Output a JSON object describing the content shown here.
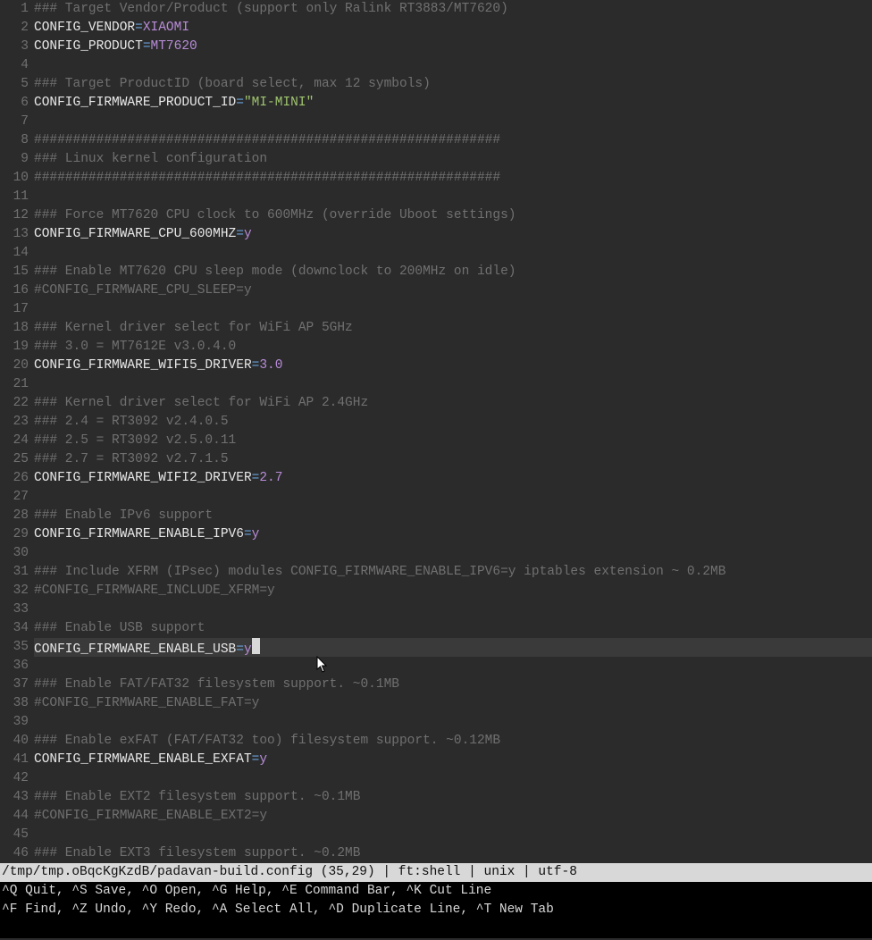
{
  "lines": [
    {
      "n": 1,
      "t": [
        [
          "### Target Vendor/Product (support only Ralink RT3883/MT7620)",
          "comment"
        ]
      ]
    },
    {
      "n": 2,
      "t": [
        [
          "CONFIG_VENDOR",
          "var"
        ],
        [
          "=",
          "op"
        ],
        [
          "XIAOMI",
          "val"
        ]
      ]
    },
    {
      "n": 3,
      "t": [
        [
          "CONFIG_PRODUCT",
          "var"
        ],
        [
          "=",
          "op"
        ],
        [
          "MT7620",
          "val"
        ]
      ]
    },
    {
      "n": 4,
      "t": [
        [
          "",
          ""
        ]
      ]
    },
    {
      "n": 5,
      "t": [
        [
          "### Target ProductID (board select, max 12 symbols)",
          "comment"
        ]
      ]
    },
    {
      "n": 6,
      "t": [
        [
          "CONFIG_FIRMWARE_PRODUCT_ID",
          "var"
        ],
        [
          "=",
          "op"
        ],
        [
          "\"MI-MINI\"",
          "str"
        ]
      ]
    },
    {
      "n": 7,
      "t": [
        [
          "",
          ""
        ]
      ]
    },
    {
      "n": 8,
      "t": [
        [
          "############################################################",
          "comment"
        ]
      ]
    },
    {
      "n": 9,
      "t": [
        [
          "### Linux kernel configuration",
          "comment"
        ]
      ]
    },
    {
      "n": 10,
      "t": [
        [
          "############################################################",
          "comment"
        ]
      ]
    },
    {
      "n": 11,
      "t": [
        [
          "",
          ""
        ]
      ]
    },
    {
      "n": 12,
      "t": [
        [
          "### Force MT7620 CPU clock to 600MHz (override Uboot settings)",
          "comment"
        ]
      ]
    },
    {
      "n": 13,
      "t": [
        [
          "CONFIG_FIRMWARE_CPU_600MHZ",
          "var"
        ],
        [
          "=",
          "op"
        ],
        [
          "y",
          "val"
        ]
      ]
    },
    {
      "n": 14,
      "t": [
        [
          "",
          ""
        ]
      ]
    },
    {
      "n": 15,
      "t": [
        [
          "### Enable MT7620 CPU sleep mode (downclock to 200MHz on idle)",
          "comment"
        ]
      ]
    },
    {
      "n": 16,
      "t": [
        [
          "#CONFIG_FIRMWARE_CPU_SLEEP=y",
          "comment"
        ]
      ]
    },
    {
      "n": 17,
      "t": [
        [
          "",
          ""
        ]
      ]
    },
    {
      "n": 18,
      "t": [
        [
          "### Kernel driver select for WiFi AP 5GHz",
          "comment"
        ]
      ]
    },
    {
      "n": 19,
      "t": [
        [
          "### 3.0 = MT7612E v3.0.4.0",
          "comment"
        ]
      ]
    },
    {
      "n": 20,
      "t": [
        [
          "CONFIG_FIRMWARE_WIFI5_DRIVER",
          "var"
        ],
        [
          "=",
          "op"
        ],
        [
          "3.0",
          "val"
        ]
      ]
    },
    {
      "n": 21,
      "t": [
        [
          "",
          ""
        ]
      ]
    },
    {
      "n": 22,
      "t": [
        [
          "### Kernel driver select for WiFi AP 2.4GHz",
          "comment"
        ]
      ]
    },
    {
      "n": 23,
      "t": [
        [
          "### 2.4 = RT3092 v2.4.0.5",
          "comment"
        ]
      ]
    },
    {
      "n": 24,
      "t": [
        [
          "### 2.5 = RT3092 v2.5.0.11",
          "comment"
        ]
      ]
    },
    {
      "n": 25,
      "t": [
        [
          "### 2.7 = RT3092 v2.7.1.5",
          "comment"
        ]
      ]
    },
    {
      "n": 26,
      "t": [
        [
          "CONFIG_FIRMWARE_WIFI2_DRIVER",
          "var"
        ],
        [
          "=",
          "op"
        ],
        [
          "2.7",
          "val"
        ]
      ]
    },
    {
      "n": 27,
      "t": [
        [
          "",
          ""
        ]
      ]
    },
    {
      "n": 28,
      "t": [
        [
          "### Enable IPv6 support",
          "comment"
        ]
      ]
    },
    {
      "n": 29,
      "t": [
        [
          "CONFIG_FIRMWARE_ENABLE_IPV6",
          "var"
        ],
        [
          "=",
          "op"
        ],
        [
          "y",
          "val"
        ]
      ]
    },
    {
      "n": 30,
      "t": [
        [
          "",
          ""
        ]
      ]
    },
    {
      "n": 31,
      "t": [
        [
          "### Include XFRM (IPsec) modules CONFIG_FIRMWARE_ENABLE_IPV6=y iptables extension ~ 0.2MB",
          "comment"
        ]
      ]
    },
    {
      "n": 32,
      "t": [
        [
          "#CONFIG_FIRMWARE_INCLUDE_XFRM=y",
          "comment"
        ]
      ]
    },
    {
      "n": 33,
      "t": [
        [
          "",
          ""
        ]
      ]
    },
    {
      "n": 34,
      "t": [
        [
          "### Enable USB support",
          "comment"
        ]
      ]
    },
    {
      "n": 35,
      "t": [
        [
          "CONFIG_FIRMWARE_ENABLE_USB",
          "var"
        ],
        [
          "=",
          "op"
        ],
        [
          "y",
          "val"
        ]
      ],
      "cursor": true
    },
    {
      "n": 36,
      "t": [
        [
          "",
          ""
        ]
      ]
    },
    {
      "n": 37,
      "t": [
        [
          "### Enable FAT/FAT32 filesystem support. ~0.1MB",
          "comment"
        ]
      ]
    },
    {
      "n": 38,
      "t": [
        [
          "#CONFIG_FIRMWARE_ENABLE_FAT=y",
          "comment"
        ]
      ]
    },
    {
      "n": 39,
      "t": [
        [
          "",
          ""
        ]
      ]
    },
    {
      "n": 40,
      "t": [
        [
          "### Enable exFAT (FAT/FAT32 too) filesystem support. ~0.12MB",
          "comment"
        ]
      ]
    },
    {
      "n": 41,
      "t": [
        [
          "CONFIG_FIRMWARE_ENABLE_EXFAT",
          "var"
        ],
        [
          "=",
          "op"
        ],
        [
          "y",
          "val"
        ]
      ]
    },
    {
      "n": 42,
      "t": [
        [
          "",
          ""
        ]
      ]
    },
    {
      "n": 43,
      "t": [
        [
          "### Enable EXT2 filesystem support. ~0.1MB",
          "comment"
        ]
      ]
    },
    {
      "n": 44,
      "t": [
        [
          "#CONFIG_FIRMWARE_ENABLE_EXT2=y",
          "comment"
        ]
      ]
    },
    {
      "n": 45,
      "t": [
        [
          "",
          ""
        ]
      ]
    },
    {
      "n": 46,
      "t": [
        [
          "### Enable EXT3 filesystem support. ~0.2MB",
          "comment"
        ]
      ]
    }
  ],
  "status": "/tmp/tmp.oBqcKgKzdB/padavan-build.config (35,29) | ft:shell | unix | utf-8",
  "help": [
    "^Q Quit, ^S Save, ^O Open, ^G Help, ^E Command Bar, ^K Cut Line",
    "^F Find, ^Z Undo, ^Y Redo, ^A Select All, ^D Duplicate Line, ^T New Tab"
  ]
}
